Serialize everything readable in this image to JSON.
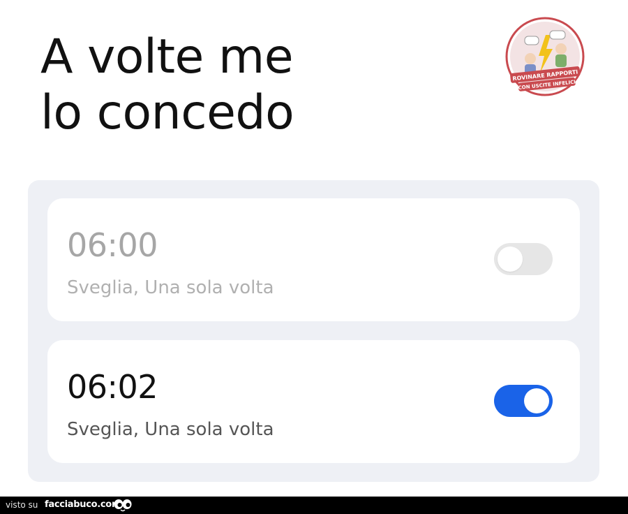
{
  "caption": {
    "line1": "A volte me",
    "line2": "lo concedo"
  },
  "logo": {
    "text_line1": "ROVINARE RAPPORTI",
    "text_line2": "CON USCITE INFELICI",
    "icon": "cartoon-characters-lightning-badge",
    "color": "#c94a4f"
  },
  "alarms": [
    {
      "time": "06:00",
      "label": "Sveglia, Una sola volta",
      "enabled": false
    },
    {
      "time": "06:02",
      "label": "Sveglia, Una sola volta",
      "enabled": true
    }
  ],
  "colors": {
    "toggle_on": "#1a63e8",
    "toggle_off": "#e6e6e6",
    "panel_bg": "#eef0f5"
  },
  "footer": {
    "visto_su": "visto su",
    "site": "facciabuco.com",
    "icon": "eyes-icon"
  }
}
